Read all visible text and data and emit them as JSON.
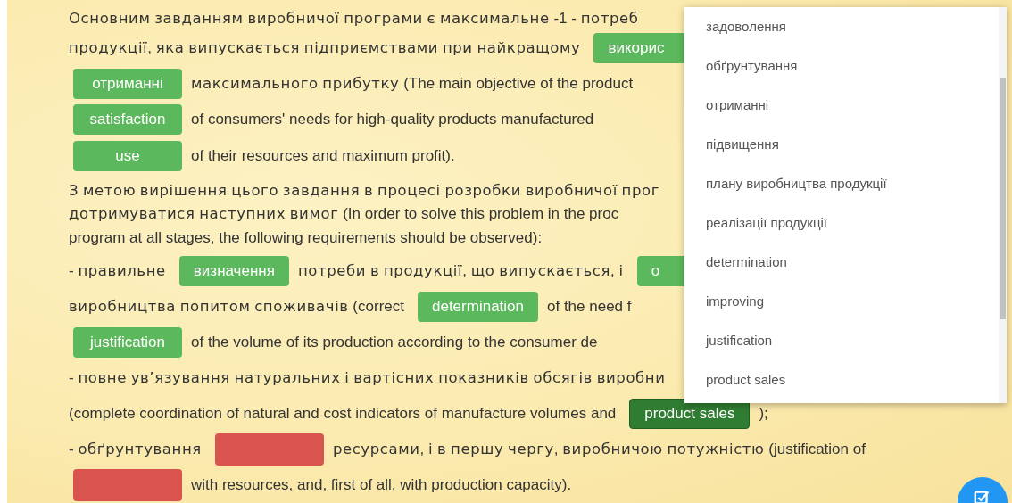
{
  "passage": [
    {
      "segments": [
        {
          "kind": "text",
          "text": "Основним завданням виробничої програми є максимальне -1 - потреб"
        }
      ]
    },
    {
      "segments": [
        {
          "kind": "text",
          "text": "продукції, яка випускається підприємствами при найкращому"
        },
        {
          "kind": "answer",
          "selected": false,
          "text": "викорис"
        }
      ]
    },
    {
      "segments": [
        {
          "kind": "answer",
          "selected": false,
          "text": "отриманні"
        },
        {
          "kind": "text",
          "text": "максимального прибутку (The main objective of the product"
        }
      ]
    },
    {
      "segments": [
        {
          "kind": "answer",
          "selected": false,
          "text": "satisfaction"
        },
        {
          "kind": "text",
          "text": "of consumers' needs for high-quality products manufactured"
        }
      ]
    },
    {
      "segments": [
        {
          "kind": "answer",
          "selected": false,
          "text": "use"
        },
        {
          "kind": "text",
          "text": "of their resources and maximum profit)."
        }
      ]
    },
    {
      "segments": [
        {
          "kind": "text",
          "text": "З метою вирішення цього завдання в процесі розробки виробничої прог"
        }
      ]
    },
    {
      "segments": [
        {
          "kind": "text",
          "text": "дотримуватися наступних вимог (In order to solve this problem in the proc"
        }
      ]
    },
    {
      "segments": [
        {
          "kind": "text",
          "text": "program at all stages, the following requirements should be observed):"
        }
      ]
    },
    {
      "segments": [
        {
          "kind": "text",
          "text": "- правильне"
        },
        {
          "kind": "answer",
          "selected": false,
          "text": "визначення"
        },
        {
          "kind": "text",
          "text": "потреби в продукції, що випускається, і"
        },
        {
          "kind": "answer",
          "selected": false,
          "text": "о"
        }
      ]
    },
    {
      "segments": [
        {
          "kind": "text",
          "text": "виробництва попитом споживачів (correct"
        },
        {
          "kind": "answer",
          "selected": false,
          "text": "determination"
        },
        {
          "kind": "text",
          "text": "of the need f"
        }
      ]
    },
    {
      "segments": [
        {
          "kind": "answer",
          "selected": false,
          "text": "justification"
        },
        {
          "kind": "text",
          "text": "of the volume of its production according to the consumer de"
        }
      ]
    },
    {
      "segments": [
        {
          "kind": "text",
          "text": "- повне ув’язування натуральних і вартісних показників обсягів виробни"
        }
      ]
    },
    {
      "segments": [
        {
          "kind": "text",
          "text": "(complete coordination of natural and cost indicators of manufacture volumes and"
        },
        {
          "kind": "answer",
          "selected": true,
          "text": "product sales"
        },
        {
          "kind": "text",
          "text": ");"
        }
      ]
    },
    {
      "segments": [
        {
          "kind": "text",
          "text": "- обґрунтування"
        },
        {
          "kind": "gap"
        },
        {
          "kind": "text",
          "text": "ресурсами, і в першу чергу, виробничою потужністю (justification of"
        }
      ]
    },
    {
      "segments": [
        {
          "kind": "gap"
        },
        {
          "kind": "text",
          "text": "with resources, and, first of all, with production capacity)."
        }
      ]
    }
  ],
  "dropdown": {
    "options": [
      "задоволення",
      "обґрунтування",
      "отриманні",
      "підвищення",
      "плану виробництва продукції",
      "реалізації продукції",
      "determination",
      "improving",
      "justification",
      "product sales"
    ]
  }
}
